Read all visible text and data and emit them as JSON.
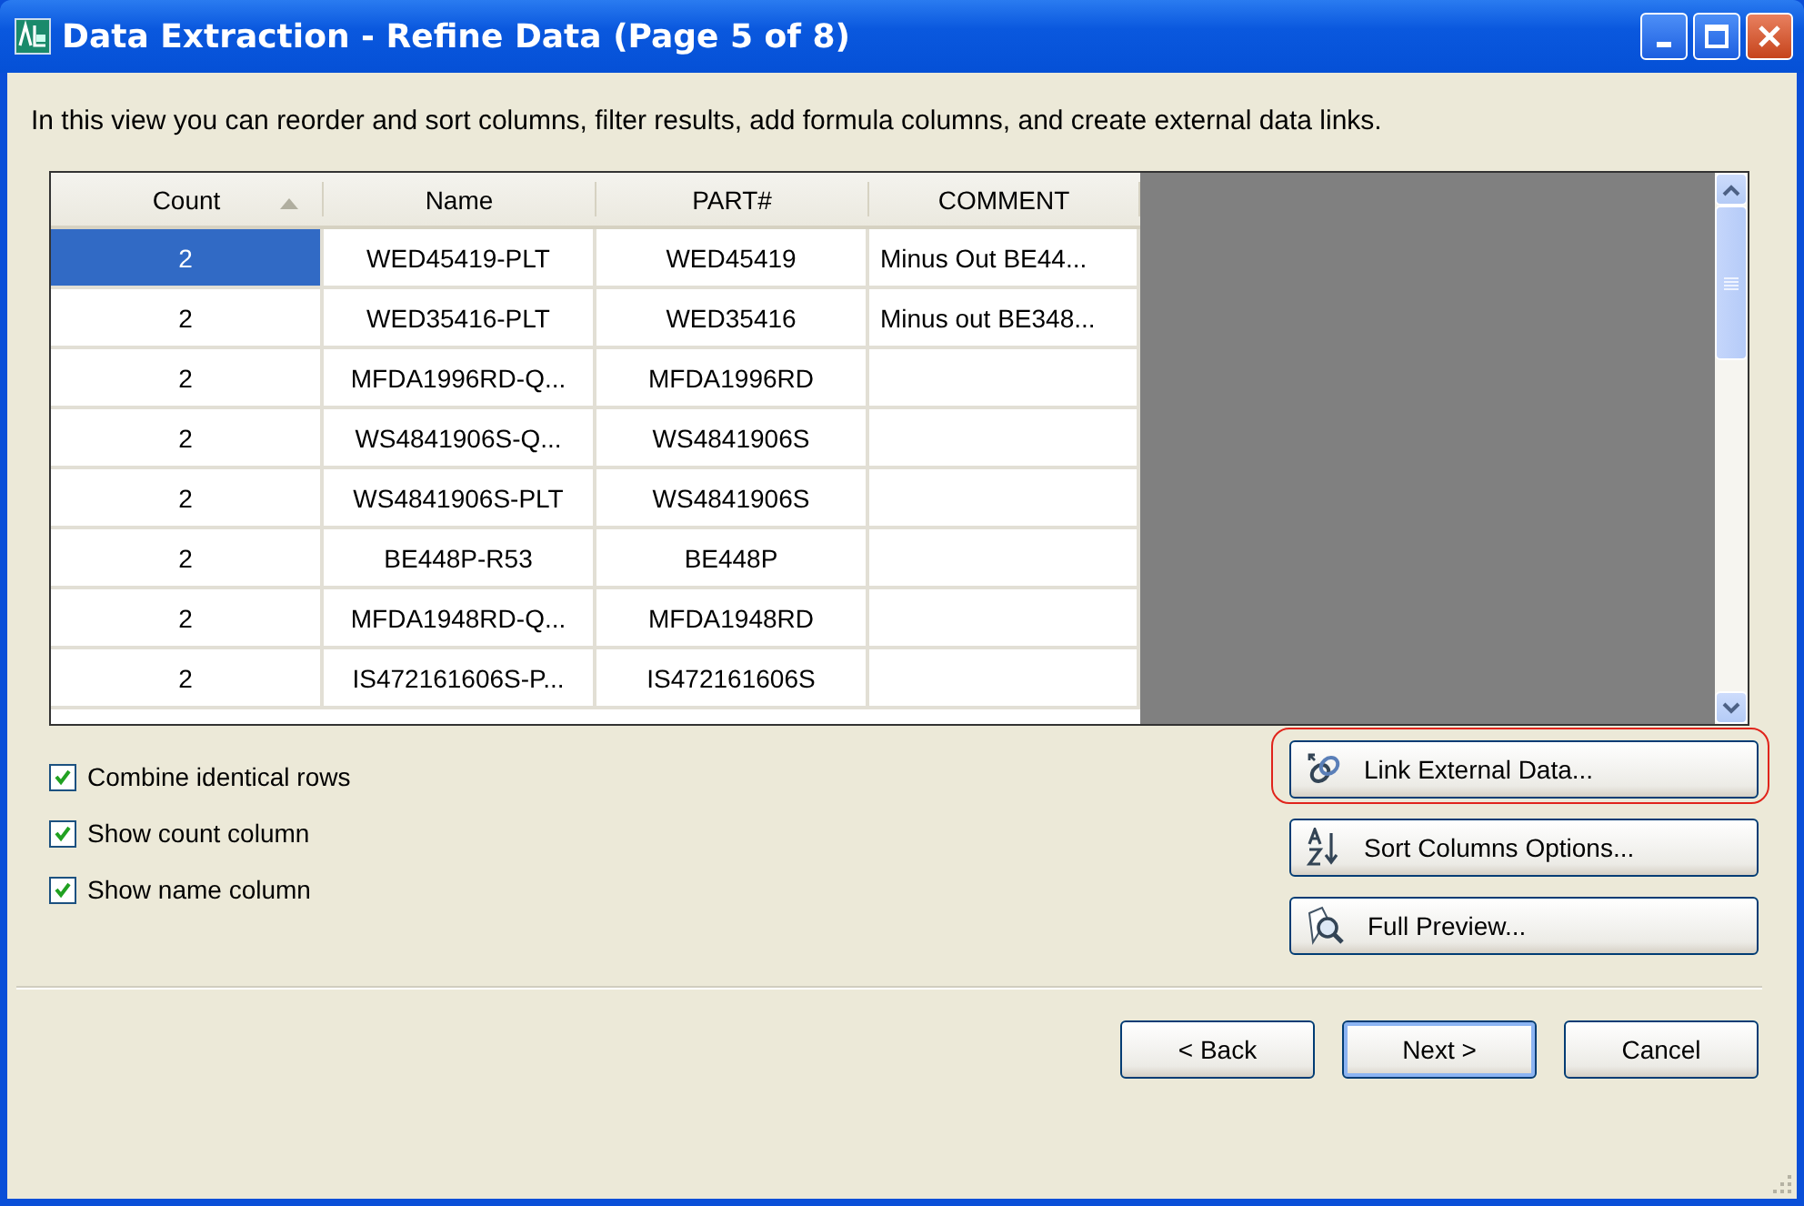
{
  "window": {
    "title": "Data Extraction - Refine Data (Page 5 of 8)"
  },
  "description": "In this view you can reorder and sort columns, filter results, add formula columns, and create external data links.",
  "table": {
    "columns": [
      {
        "label": "Count",
        "sorted": true
      },
      {
        "label": "Name",
        "sorted": false
      },
      {
        "label": "PART#",
        "sorted": false
      },
      {
        "label": "COMMENT",
        "sorted": false
      }
    ],
    "rows": [
      {
        "selected": true,
        "cells": [
          "2",
          "WED45419-PLT",
          "WED45419",
          "Minus Out BE44..."
        ]
      },
      {
        "selected": false,
        "cells": [
          "2",
          "WED35416-PLT",
          "WED35416",
          "Minus out BE348..."
        ]
      },
      {
        "selected": false,
        "cells": [
          "2",
          "MFDA1996RD-Q...",
          "MFDA1996RD",
          ""
        ]
      },
      {
        "selected": false,
        "cells": [
          "2",
          "WS4841906S-Q...",
          "WS4841906S",
          ""
        ]
      },
      {
        "selected": false,
        "cells": [
          "2",
          "WS4841906S-PLT",
          "WS4841906S",
          ""
        ]
      },
      {
        "selected": false,
        "cells": [
          "2",
          "BE448P-R53",
          "BE448P",
          ""
        ]
      },
      {
        "selected": false,
        "cells": [
          "2",
          "MFDA1948RD-Q...",
          "MFDA1948RD",
          ""
        ]
      },
      {
        "selected": false,
        "cells": [
          "2",
          "IS472161606S-P...",
          "IS472161606S",
          ""
        ]
      }
    ]
  },
  "options": [
    {
      "label": "Combine identical rows",
      "checked": true
    },
    {
      "label": "Show count column",
      "checked": true
    },
    {
      "label": "Show name column",
      "checked": true
    }
  ],
  "side_buttons": [
    {
      "label": "Link External Data...",
      "kind": "link",
      "highlighted": true
    },
    {
      "label": "Sort Columns Options...",
      "kind": "sort",
      "highlighted": false
    },
    {
      "label": "Full Preview...",
      "kind": "preview",
      "highlighted": false
    }
  ],
  "nav_buttons": [
    {
      "label": "< Back",
      "default": false
    },
    {
      "label": "Next >",
      "default": true
    },
    {
      "label": "Cancel",
      "default": false
    }
  ]
}
